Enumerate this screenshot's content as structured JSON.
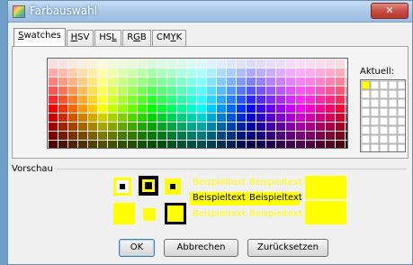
{
  "window": {
    "title": "Farbauswahl",
    "close_glyph": "✕"
  },
  "tabs": [
    {
      "label": "Swatches",
      "mnemonic": "S",
      "rest": "watches"
    },
    {
      "label": "HSV",
      "mnemonic": "H",
      "rest": "SV"
    },
    {
      "label": "HSL",
      "pre": "HS",
      "mnemonic": "L"
    },
    {
      "label": "RGB",
      "pre": "R",
      "mnemonic": "G",
      "rest": "B"
    },
    {
      "label": "CMYK",
      "pre": "CM",
      "mnemonic": "Y",
      "rest": "K"
    }
  ],
  "active_tab": "Swatches",
  "swatches": {
    "recent_label": "Aktuell:",
    "recent_selected_color": "#ffff00"
  },
  "preview": {
    "title": "Vorschau",
    "sample_text": "Beispieltext",
    "selected_color": "#ffff00"
  },
  "buttons": {
    "ok": "OK",
    "cancel": "Abbrechen",
    "reset": "Zurücksetzen"
  }
}
